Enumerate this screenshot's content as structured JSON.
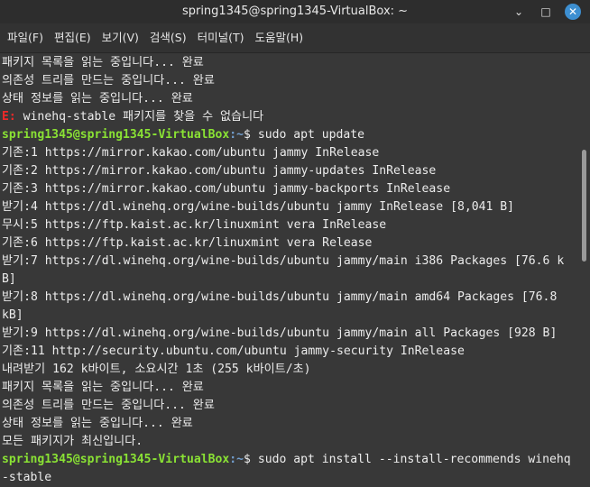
{
  "window": {
    "title": "spring1345@spring1345-VirtualBox: ~",
    "minimize_glyph": "⌄",
    "maximize_glyph": "□",
    "close_glyph": "✕"
  },
  "menu": [
    {
      "label": "파일(F)"
    },
    {
      "label": "편집(E)"
    },
    {
      "label": "보기(V)"
    },
    {
      "label": "검색(S)"
    },
    {
      "label": "터미널(T)"
    },
    {
      "label": "도움말(H)"
    }
  ],
  "terminal": {
    "colors": {
      "background": "#383838",
      "text": "#ececec",
      "user": "#8ae234",
      "path": "#729fcf",
      "error": "#ef2929"
    },
    "lines": [
      {
        "text": "패키지 목록을 읽는 중입니다... 완료"
      },
      {
        "text": "의존성 트리를 만드는 중입니다... 완료"
      },
      {
        "text": "상태 정보를 읽는 중입니다... 완료"
      },
      {
        "err": "E:",
        "text": " winehq-stable 패키지를 찾을 수 없습니다"
      },
      {
        "user": "spring1345@spring1345-VirtualBox",
        "path": ":~",
        "text": "$ sudo apt update"
      },
      {
        "text": "기존:1 https://mirror.kakao.com/ubuntu jammy InRelease"
      },
      {
        "text": "기존:2 https://mirror.kakao.com/ubuntu jammy-updates InRelease"
      },
      {
        "text": "기존:3 https://mirror.kakao.com/ubuntu jammy-backports InRelease"
      },
      {
        "text": "받기:4 https://dl.winehq.org/wine-builds/ubuntu jammy InRelease [8,041 B]"
      },
      {
        "text": "무시:5 https://ftp.kaist.ac.kr/linuxmint vera InRelease"
      },
      {
        "text": "기존:6 https://ftp.kaist.ac.kr/linuxmint vera Release"
      },
      {
        "text": "받기:7 https://dl.winehq.org/wine-builds/ubuntu jammy/main i386 Packages [76.6 k"
      },
      {
        "text": "B]"
      },
      {
        "text": "받기:8 https://dl.winehq.org/wine-builds/ubuntu jammy/main amd64 Packages [76.8"
      },
      {
        "text": "kB]"
      },
      {
        "text": "받기:9 https://dl.winehq.org/wine-builds/ubuntu jammy/main all Packages [928 B]"
      },
      {
        "text": "기존:11 http://security.ubuntu.com/ubuntu jammy-security InRelease"
      },
      {
        "text": "내려받기 162 k바이트, 소요시간 1초 (255 k바이트/초)"
      },
      {
        "text": "패키지 목록을 읽는 중입니다... 완료"
      },
      {
        "text": "의존성 트리를 만드는 중입니다... 완료"
      },
      {
        "text": "상태 정보를 읽는 중입니다... 완료"
      },
      {
        "text": "모든 패키지가 최신입니다."
      },
      {
        "user": "spring1345@spring1345-VirtualBox",
        "path": ":~",
        "text": "$ sudo apt install --install-recommends winehq"
      },
      {
        "text": "-stable"
      }
    ]
  }
}
